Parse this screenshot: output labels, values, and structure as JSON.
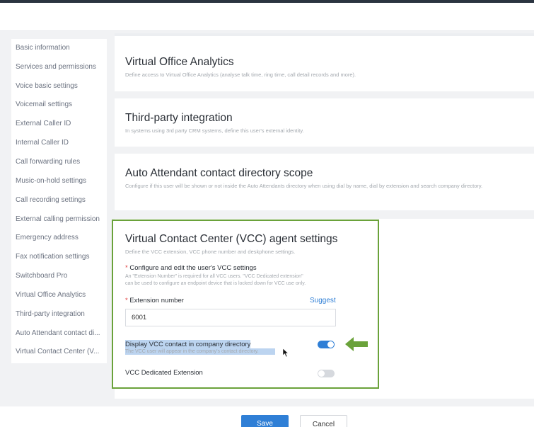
{
  "sidebar": {
    "items": [
      {
        "label": "Basic information"
      },
      {
        "label": "Services and permissions"
      },
      {
        "label": "Voice basic settings"
      },
      {
        "label": "Voicemail settings"
      },
      {
        "label": "External Caller ID"
      },
      {
        "label": "Internal Caller ID"
      },
      {
        "label": "Call forwarding rules"
      },
      {
        "label": "Music-on-hold settings"
      },
      {
        "label": "Call recording settings"
      },
      {
        "label": "External calling permission"
      },
      {
        "label": "Emergency address"
      },
      {
        "label": "Fax notification settings"
      },
      {
        "label": "Switchboard Pro"
      },
      {
        "label": "Virtual Office Analytics"
      },
      {
        "label": "Third-party integration"
      },
      {
        "label": "Auto Attendant contact di..."
      },
      {
        "label": "Virtual Contact Center (V..."
      }
    ]
  },
  "cards": {
    "analytics": {
      "title": "Virtual Office Analytics",
      "desc": "Define access to Virtual Office Analytics (analyse talk time, ring time, call detail records and more)."
    },
    "thirdparty": {
      "title": "Third-party integration",
      "desc": "In systems using 3rd party CRM systems, define this user's external identity."
    },
    "autoattendant": {
      "title": "Auto Attendant contact directory scope",
      "desc": "Configure if this user will be shown or not inside the Auto Attendants directory when using dial by name, dial by extension and search company directory."
    }
  },
  "vcc": {
    "title": "Virtual Contact Center (VCC) agent settings",
    "desc": "Define the VCC extension, VCC phone number and deskphone settings.",
    "configure_label": "Configure and edit the user's VCC settings",
    "configure_help_1": "An \"Extension Number\" is required for all VCC users. \"VCC Dedicated extension\"",
    "configure_help_2": "can be used to configure an endpoint device that is locked down for VCC use only.",
    "extension_label": "Extension number",
    "suggest_label": "Suggest",
    "extension_value": "6001",
    "display_label": "Display VCC contact in company directory",
    "display_help": "The VCC user will appear in the company's contact directory.",
    "display_on": true,
    "dedicated_label": "VCC Dedicated Extension",
    "dedicated_on": false,
    "required_mark": "*"
  },
  "footer": {
    "save_label": "Save",
    "cancel_label": "Cancel"
  },
  "colors": {
    "accent": "#2f7fd6",
    "highlight_border": "#6aa23a",
    "arrow": "#6aa23a",
    "toggle_on": "#2f7fd6",
    "toggle_off": "#d6d9de"
  }
}
